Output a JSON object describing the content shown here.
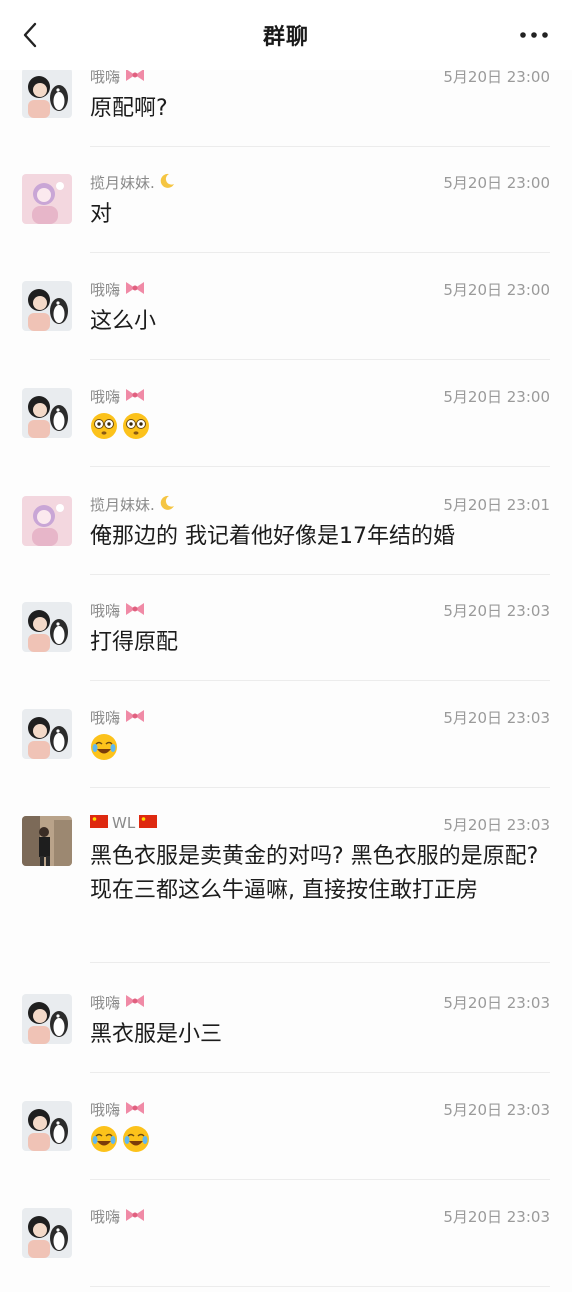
{
  "header": {
    "title": "群聊",
    "back_icon": "back-chevron-icon",
    "more_icon": "more-dots-icon"
  },
  "colors": {
    "name": "#8a8a8a",
    "time": "#9a9a9a",
    "text": "#1c1c1c",
    "divider": "#ececec",
    "bow": "#f08aa6"
  },
  "messages": [
    {
      "sender": "哦嗨",
      "badge": "bow-icon",
      "time": "5月20日 23:00",
      "text": "原配啊?",
      "avatar": "girl-penguin-avatar"
    },
    {
      "sender": "揽月妹妹.",
      "badge": "crescent-moon-icon",
      "time": "5月20日 23:00",
      "text": "对",
      "avatar": "pink-anime-avatar"
    },
    {
      "sender": "哦嗨",
      "badge": "bow-icon",
      "time": "5月20日 23:00",
      "text": "这么小",
      "avatar": "girl-penguin-avatar"
    },
    {
      "sender": "哦嗨",
      "badge": "bow-icon",
      "time": "5月20日 23:00",
      "text": "",
      "emojis": [
        "flushed-emoji",
        "flushed-emoji"
      ],
      "avatar": "girl-penguin-avatar"
    },
    {
      "sender": "揽月妹妹.",
      "badge": "crescent-moon-icon",
      "time": "5月20日 23:01",
      "text": "俺那边的 我记着他好像是17年结的婚",
      "avatar": "pink-anime-avatar"
    },
    {
      "sender": "哦嗨",
      "badge": "bow-icon",
      "time": "5月20日 23:03",
      "text": "打得原配",
      "avatar": "girl-penguin-avatar"
    },
    {
      "sender": "哦嗨",
      "badge": "bow-icon",
      "time": "5月20日 23:03",
      "text": "",
      "emojis": [
        "rolling-laugh-emoji"
      ],
      "avatar": "girl-penguin-avatar"
    },
    {
      "sender": "WL",
      "badge": "china-flag-icon",
      "time": "5月20日 23:03",
      "text": "黑色衣服是卖黄金的对吗? 黑色衣服的是原配? 现在三都这么牛逼嘛, 直接按住敢打正房",
      "avatar": "street-photo-avatar"
    },
    {
      "sender": "哦嗨",
      "badge": "bow-icon",
      "time": "5月20日 23:03",
      "text": "黑衣服是小三",
      "avatar": "girl-penguin-avatar"
    },
    {
      "sender": "哦嗨",
      "badge": "bow-icon",
      "time": "5月20日 23:03",
      "text": "",
      "emojis": [
        "rolling-laugh-emoji",
        "rolling-laugh-emoji"
      ],
      "avatar": "girl-penguin-avatar"
    },
    {
      "sender": "哦嗨",
      "badge": "bow-icon",
      "time": "5月20日 23:03",
      "text": "",
      "avatar": "girl-penguin-avatar"
    }
  ]
}
